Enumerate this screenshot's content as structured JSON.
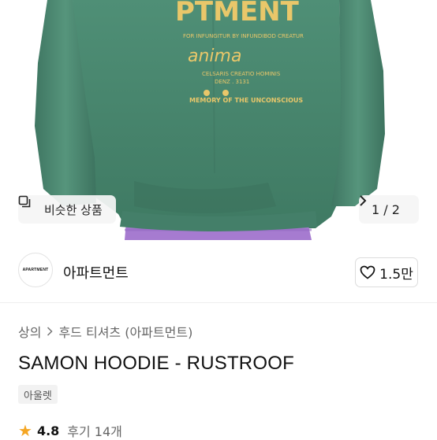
{
  "hero": {
    "similar_label": "비슷한 상품",
    "similar_icon": "copy-icon",
    "pager_current": "1",
    "pager_total": "2",
    "pager_text": "1 / 2",
    "print_big": "PTMENT",
    "print_line1": "FOR INFUNGITUR BY INFUNDIBOD CREATUR",
    "print_logo": "anima",
    "print_line2": "CELSARIS CREATIO HOMINIS",
    "print_line3": "DENZ . 3131",
    "print_line4": "MEMORY OF THE UNCONSCIOUS"
  },
  "brand": {
    "logo_text": "APARTMENT",
    "name": "아파트먼트",
    "likes": "1.5만",
    "heart_icon": "heart-icon"
  },
  "product": {
    "breadcrumb": [
      "상의",
      "후드 티셔츠 (아파트먼트)"
    ],
    "title": "SAMON HOODIE - RUSTROOF",
    "tag": "아울렛",
    "rating": "4.8",
    "reviews": "후기 14개"
  },
  "colors": {
    "hoodie_green": "#4f8f76",
    "print_yellow": "#e9c76a",
    "pants_purple": "#a67bd0",
    "star": "#f5a623"
  }
}
